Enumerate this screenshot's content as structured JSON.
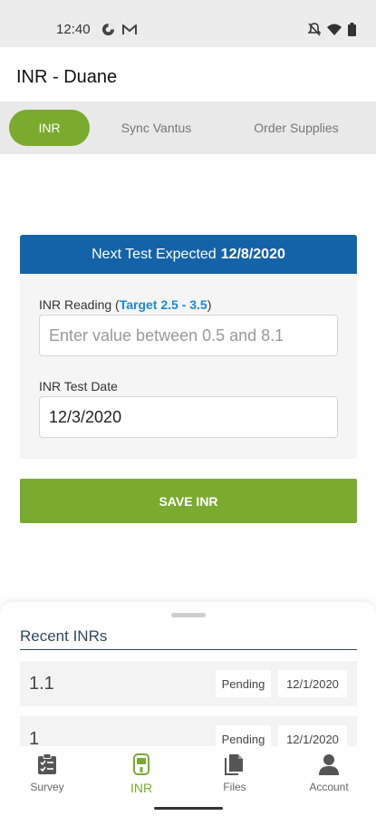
{
  "status_bar": {
    "time": "12:40",
    "left_icons": [
      "data-saver-icon",
      "gmail-icon"
    ],
    "right_icons": [
      "mute-icon",
      "wifi-icon",
      "battery-icon"
    ]
  },
  "header": {
    "title": "INR - Duane"
  },
  "tabs": [
    {
      "label": "INR",
      "active": true
    },
    {
      "label": "Sync Vantus",
      "active": false
    },
    {
      "label": "Order Supplies",
      "active": false
    }
  ],
  "card": {
    "header_prefix": "Next Test Expected",
    "header_date": "12/8/2020",
    "reading_label": "INR Reading (",
    "target_text": "Target 2.5 - 3.5",
    "reading_label_close": ")",
    "reading_placeholder": "Enter value between 0.5 and 8.1",
    "reading_value": "",
    "date_label": "INR Test Date",
    "date_value": "12/3/2020"
  },
  "save_button": {
    "label": "SAVE INR"
  },
  "recent": {
    "title": "Recent INRs",
    "rows": [
      {
        "value": "1.1",
        "status": "Pending",
        "date": "12/1/2020"
      },
      {
        "value": "1",
        "status": "Pending",
        "date": "12/1/2020"
      }
    ]
  },
  "bottom_nav": [
    {
      "label": "Survey",
      "icon": "survey-icon",
      "active": false
    },
    {
      "label": "INR",
      "icon": "inr-meter-icon",
      "active": true
    },
    {
      "label": "Files",
      "icon": "files-icon",
      "active": false
    },
    {
      "label": "Account",
      "icon": "account-icon",
      "active": false
    }
  ],
  "colors": {
    "accent_green": "#7aaa2e",
    "header_blue": "#1463a8",
    "target_blue": "#1a8ad6",
    "section_title": "#2f4a5a"
  }
}
